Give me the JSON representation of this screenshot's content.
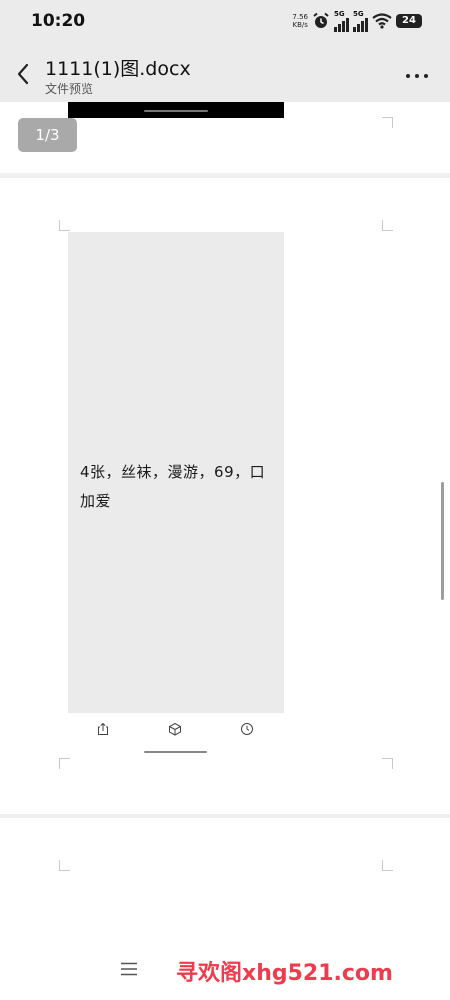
{
  "status_bar": {
    "time": "10:20",
    "net_speed_value": "7.56",
    "net_speed_unit": "KB/s",
    "signal_1_label": "5G",
    "signal_2_label": "5G",
    "battery": "24",
    "icons": [
      "alarm-icon",
      "signal-icon",
      "signal-icon",
      "wifi-icon",
      "battery-icon"
    ]
  },
  "header": {
    "title": "1111(1)图.docx",
    "subtitle": "文件预览",
    "icons": [
      "back-icon",
      "more-icon"
    ]
  },
  "viewer": {
    "page_indicator": "1/3",
    "embedded_text": "4张，丝袜，漫游，69，口\n加爱",
    "mini_toolbar_icons": [
      "share-icon",
      "box-icon",
      "clock-icon"
    ]
  },
  "bottom": {
    "menu_icon": "menu-icon",
    "watermark": "寻欢阁xhg521.com"
  },
  "colors": {
    "chrome_bg": "#ebebeb",
    "page_bg": "#ffffff",
    "indicator_bg": "#a9a9a9",
    "watermark": "#ee3b4d"
  }
}
